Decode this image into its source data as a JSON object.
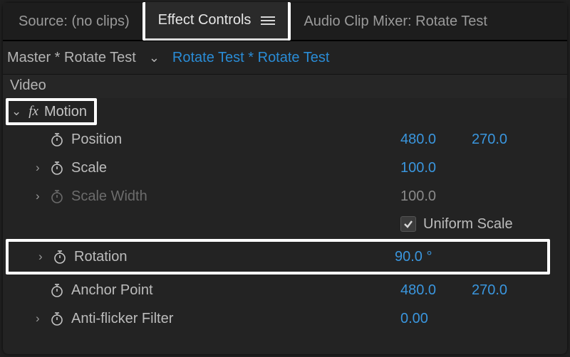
{
  "tabs": {
    "source": "Source: (no clips)",
    "effect_controls": "Effect Controls",
    "audio_mixer": "Audio Clip Mixer: Rotate Test"
  },
  "master": {
    "master_text": "Master * Rotate Test",
    "clip_text": "Rotate Test * Rotate Test"
  },
  "video_header": "Video",
  "motion": {
    "label": "Motion"
  },
  "props": {
    "position": {
      "label": "Position",
      "x": "480.0",
      "y": "270.0"
    },
    "scale": {
      "label": "Scale",
      "value": "100.0"
    },
    "scale_width": {
      "label": "Scale Width",
      "value": "100.0"
    },
    "uniform_scale": {
      "label": "Uniform Scale",
      "checked": true
    },
    "rotation": {
      "label": "Rotation",
      "value": "90.0 °"
    },
    "anchor_point": {
      "label": "Anchor Point",
      "x": "480.0",
      "y": "270.0"
    },
    "anti_flicker": {
      "label": "Anti-flicker Filter",
      "value": "0.00"
    }
  }
}
